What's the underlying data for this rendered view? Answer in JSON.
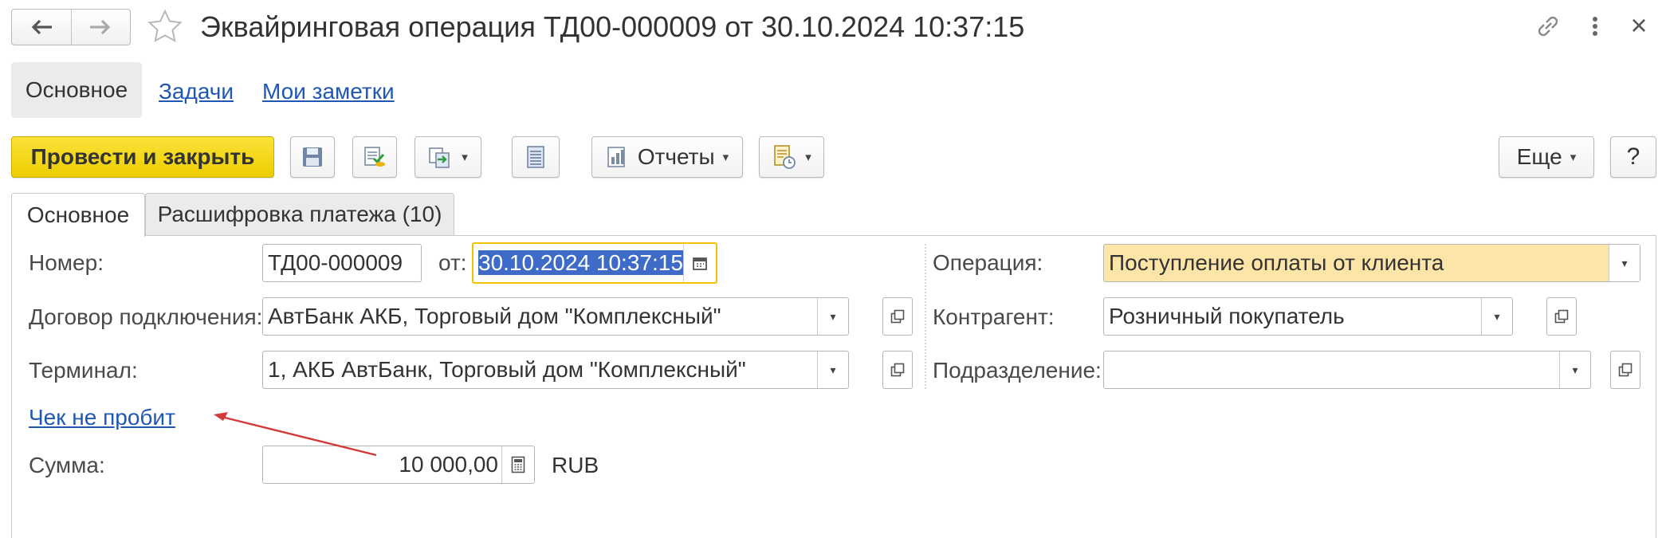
{
  "window": {
    "title": "Эквайринговая операция ТД00-000009 от 30.10.2024 10:37:15",
    "back_icon": "arrow-left-icon",
    "forward_icon": "arrow-right-icon",
    "favorite_icon": "star-icon",
    "link_icon": "link-icon",
    "more_icon": "vertical-dots-icon",
    "close_label": "×"
  },
  "nav_tabs": [
    {
      "label": "Основное",
      "active": true
    },
    {
      "label": "Задачи",
      "active": false
    },
    {
      "label": "Мои заметки",
      "active": false
    }
  ],
  "toolbar": {
    "post_close": "Провести и закрыть",
    "reports": "Отчеты",
    "more": "Еще",
    "help": "?",
    "caret": "▾",
    "accent_color": "#f5d80d"
  },
  "form_tabs": [
    {
      "label": "Основное",
      "active": true
    },
    {
      "label": "Расшифровка платежа (10)",
      "active": false
    }
  ],
  "form": {
    "number_label": "Номер:",
    "number_value": "ТД00-000009",
    "from_label": "от:",
    "date_value": "30.10.2024 10:37:15",
    "contract_label": "Договор подключения:",
    "contract_value": "АвтБанк АКБ, Торговый дом \"Комплексный\"",
    "terminal_label": "Терминал:",
    "terminal_value": "1, АКБ АвтБанк, Торговый дом \"Комплексный\"",
    "receipt_link": "Чек не пробит",
    "amount_label": "Сумма:",
    "amount_value": "10 000,00",
    "currency": "RUB",
    "operation_label": "Операция:",
    "operation_value": "Поступление оплаты от клиента",
    "counterparty_label": "Контрагент:",
    "counterparty_value": "Розничный покупатель",
    "division_label": "Подразделение:",
    "division_value": ""
  }
}
